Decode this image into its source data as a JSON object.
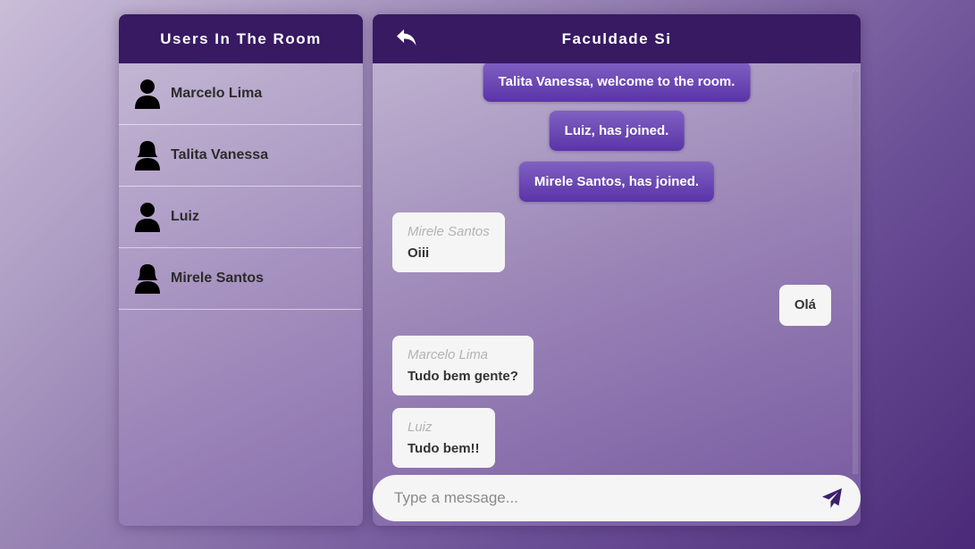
{
  "users_panel": {
    "title": "Users In The Room",
    "users": [
      {
        "name": "Marcelo Lima",
        "icon": "male-user-icon"
      },
      {
        "name": "Talita Vanessa",
        "icon": "female-user-icon"
      },
      {
        "name": "Luiz",
        "icon": "male-user-icon"
      },
      {
        "name": "Mirele Santos",
        "icon": "female-user-icon"
      }
    ]
  },
  "chat": {
    "room_title": "Faculdade Si",
    "back_icon": "reply-arrow-icon",
    "system_messages": [
      "Talita Vanessa, welcome to the room.",
      "Luiz, has joined.",
      "Mirele Santos, has joined."
    ],
    "messages": [
      {
        "author": "Mirele Santos",
        "text": "Oiii",
        "own": false
      },
      {
        "author": "",
        "text": "Olá",
        "own": true
      },
      {
        "author": "Marcelo Lima",
        "text": "Tudo bem gente?",
        "own": false
      },
      {
        "author": "Luiz",
        "text": "Tudo bem!!",
        "own": false
      }
    ]
  },
  "composer": {
    "placeholder": "Type a message...",
    "send_icon": "paper-plane-icon"
  },
  "colors": {
    "header": "#371a62",
    "system_message": "#6a47b3",
    "bubble": "#f5f5f5",
    "send_icon": "#3b1f6b"
  }
}
